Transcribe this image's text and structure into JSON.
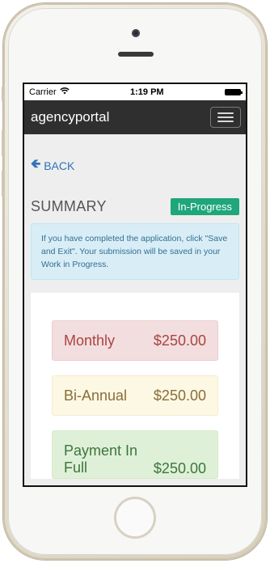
{
  "status_bar": {
    "carrier": "Carrier",
    "wifi_icon": "wifi-icon",
    "time": "1:19 PM",
    "battery_icon": "battery-icon"
  },
  "navbar": {
    "brand": "agencyportal",
    "menu_icon": "hamburger-menu-icon"
  },
  "back": {
    "icon": "arrow-left-icon",
    "label": "BACK"
  },
  "summary": {
    "title": "SUMMARY",
    "status": "In-Progress"
  },
  "alert": {
    "text": "If you have completed the application, click \"Save and Exit\". Your submission will be saved in your Work in Progress."
  },
  "plans": [
    {
      "name": "Monthly",
      "price": "$250.00"
    },
    {
      "name": "Bi-Annual",
      "price": "$250.00"
    },
    {
      "name": "Payment In Full",
      "price": "$250.00"
    }
  ],
  "colors": {
    "navbar": "#2f2f2f",
    "link": "#2f73b9",
    "badge": "#1fa67a",
    "alert_bg": "#d9edf7",
    "monthly_bg": "#f2dede",
    "biannual_bg": "#fcf8e3",
    "full_bg": "#dff0d8"
  }
}
